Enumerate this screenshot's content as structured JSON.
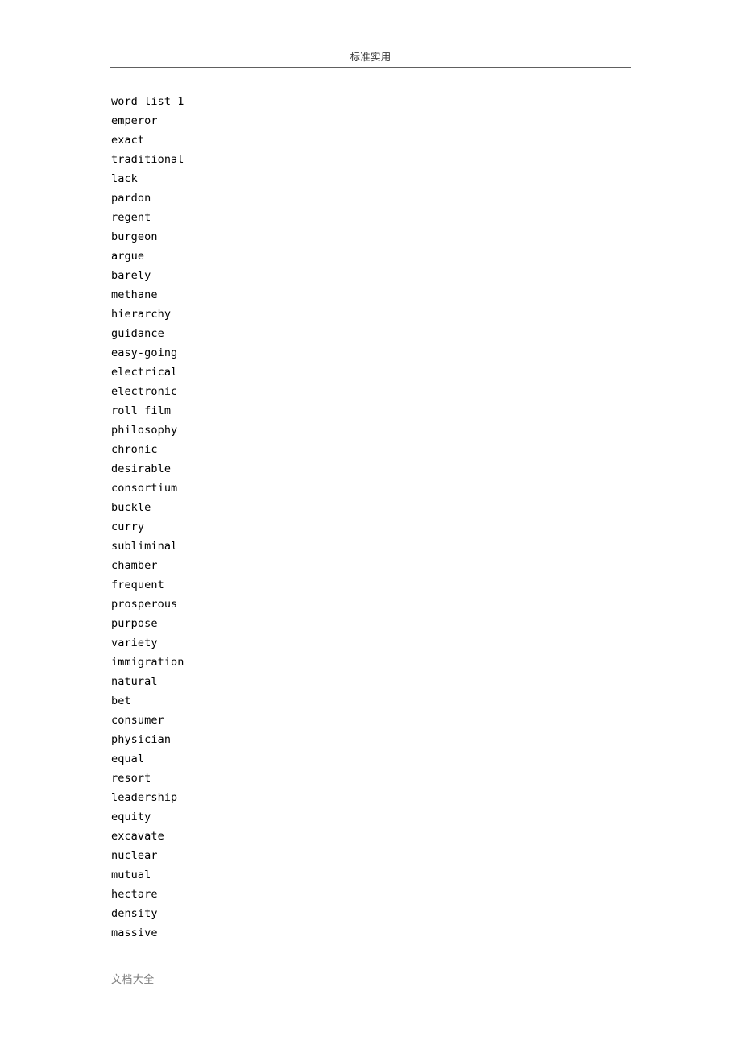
{
  "document": {
    "header": {
      "text": "标准实用",
      "rule_color": "#606060"
    },
    "footer": {
      "text": "文档大全",
      "color": "#7d7d7d"
    },
    "body": {
      "lines": [
        "word list 1",
        "emperor",
        "exact",
        "traditional",
        "lack",
        "pardon",
        "regent",
        "burgeon",
        "argue",
        "barely",
        "methane",
        "hierarchy",
        "guidance",
        "easy-going",
        "electrical",
        "electronic",
        "roll film",
        "philosophy",
        "chronic",
        "desirable",
        "consortium",
        "buckle",
        "curry",
        "subliminal",
        "chamber",
        "frequent",
        "prosperous",
        "purpose",
        "variety",
        "immigration",
        "natural",
        "bet",
        "consumer",
        "physician",
        "equal",
        "resort",
        "leadership",
        "equity",
        "excavate",
        "nuclear",
        "mutual",
        "hectare",
        "density",
        "massive"
      ]
    }
  }
}
